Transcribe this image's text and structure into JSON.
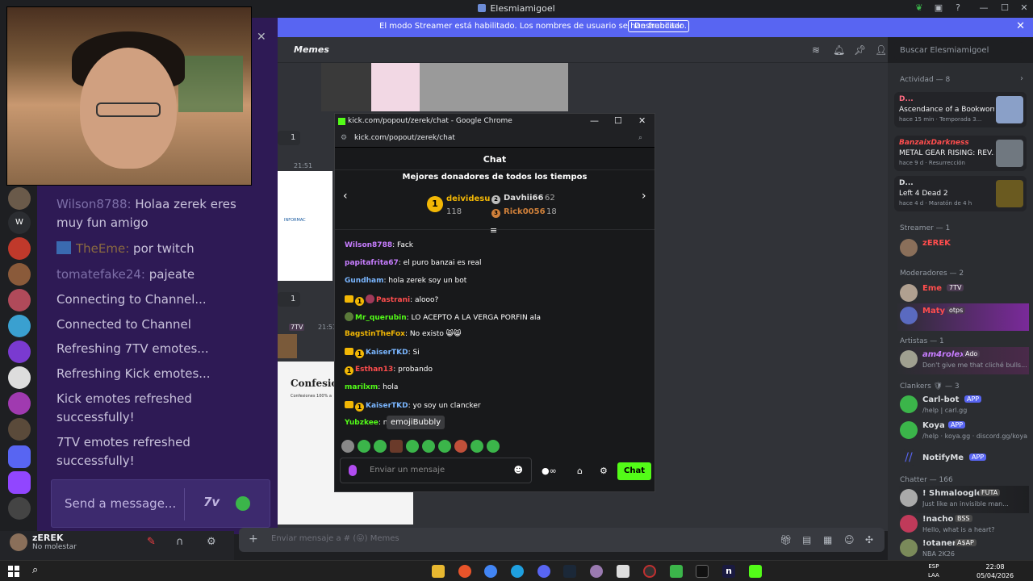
{
  "window": {
    "title": "Elesmiamigoel"
  },
  "banner": {
    "message": "El modo Streamer está habilitado. Los nombres de usuario se han truncado.",
    "button": "Deshabilitar"
  },
  "discord": {
    "channel": "Memes",
    "search_placeholder": "Buscar Elesmiamigoel",
    "input_placeholder": "Enviar mensaje a # (😛) Memes",
    "messages": [
      {
        "time": "21:51",
        "reaction_count": "1"
      },
      {
        "time": "21:51",
        "reaction_count": "1"
      },
      {
        "badge": "7TV",
        "time": "21:51"
      }
    ],
    "doc_preview": {
      "label1": "INFORMAC",
      "label2": "Confesion",
      "label3": "Confesiones 100% a"
    },
    "user": {
      "name": "zEREK",
      "status": "No molestar"
    }
  },
  "overlay": {
    "lines": [
      {
        "name": "Wilson8788:",
        "text": " Holaa zerek eres muy fun amigo"
      },
      {
        "name": "TheEme:",
        "text": " por twitch"
      },
      {
        "name": "tomatefake24:",
        "text": " pajeate"
      },
      {
        "text": "Connecting to Channel..."
      },
      {
        "text": "Connected to Channel"
      },
      {
        "text": "Refreshing 7TV emotes..."
      },
      {
        "text": "Refreshing Kick emotes..."
      },
      {
        "text": "Kick emotes refreshed successfully!"
      },
      {
        "text": "7TV emotes refreshed successfully!"
      }
    ],
    "input_placeholder": "Send a message...",
    "seventv_label": "7v"
  },
  "kick": {
    "window_title": "kick.com/popout/zerek/chat - Google Chrome",
    "url": "kick.com/popout/zerek/chat",
    "chat_title": "Chat",
    "donors_title": "Mejores donadores de todos los tiempos",
    "donors": [
      {
        "rank": "1",
        "name": "deividesu",
        "amount": "118"
      },
      {
        "rank": "2",
        "name": "Davhii66",
        "amount": "62"
      },
      {
        "rank": "3",
        "name": "Rick0056",
        "amount": "18"
      }
    ],
    "messages": [
      {
        "user": "Wilson8788",
        "color": "#c77dff",
        "text": ": Fack"
      },
      {
        "user": "papitafrita67",
        "color": "#c77dff",
        "text": ": el puro banzai es real"
      },
      {
        "user": "Gundham",
        "color": "#7ab6ff",
        "text": ": hola zerek soy un bot"
      },
      {
        "user": "Pastrani",
        "color": "#ff4d4d",
        "text": ": alooo?"
      },
      {
        "user": "Mr_querubin",
        "color": "#53fc18",
        "text": ": LO ACEPTO A LA VERGA PORFIN ala"
      },
      {
        "user": "BagstinTheFox",
        "color": "#f2b705",
        "text": ": No existo 😸😸"
      },
      {
        "user": "KaiserTKD",
        "color": "#7ab6ff",
        "text": ": Si"
      },
      {
        "user": "Esthan13",
        "color": "#ff4d4d",
        "text": ": probando"
      },
      {
        "user": "marilxm",
        "color": "#53fc18",
        "text": ": hola"
      },
      {
        "user": "KaiserTKD",
        "color": "#7ab6ff",
        "text": ": yo soy un clancker"
      },
      {
        "user": "Yubzkee",
        "color": "#53fc18",
        "text": ": n"
      }
    ],
    "tooltip": "emojiBubbly",
    "input_placeholder": "Enviar un mensaje",
    "send_button": "Chat"
  },
  "members": {
    "activity_header": "Actividad — 8",
    "activities": [
      {
        "user": "D...",
        "title": "Ascendance of a Bookworm",
        "meta": "hace 15 min · Temporada 3...",
        "color": "#ff6b81"
      },
      {
        "user": "BanzaixDarkness",
        "title": "METAL GEAR RISING: REV...",
        "meta": "hace 9 d · Resurrección",
        "color": "#ff4d4d"
      },
      {
        "user": "D...",
        "title": "Left 4 Dead 2",
        "meta": "hace 4 d · Maratón de 4 h",
        "color": "#f2f3f5"
      }
    ],
    "groups": [
      {
        "header": "Streamer — 1",
        "rows": [
          {
            "name": "zEREK",
            "color": "#ff4d4d",
            "sub": ""
          }
        ]
      },
      {
        "header": "Moderadores — 2",
        "rows": [
          {
            "name": "Eme",
            "color": "#ff4d4d",
            "badge": "7TV",
            "sub": ""
          },
          {
            "name": "Maty",
            "color": "#ff4d4d",
            "badge": "otps",
            "sub": ""
          }
        ]
      },
      {
        "header": "Artistas — 1",
        "rows": [
          {
            "name": "am4rolex",
            "color": "#c77dff",
            "badge": "Ado",
            "sub": "Don't give me that cliché bulls..."
          }
        ]
      },
      {
        "header": "Clankers 🛡 — 3",
        "rows": [
          {
            "name": "Carl-bot",
            "color": "#f2f3f5",
            "badge": "APP",
            "sub": "/help | carl.gg"
          },
          {
            "name": "Koya",
            "color": "#f2f3f5",
            "badge": "APP",
            "sub": "/help · koya.gg · discord.gg/koya"
          },
          {
            "name": "NotifyMe",
            "color": "#f2f3f5",
            "badge": "APP",
            "sub": ""
          }
        ]
      },
      {
        "header": "Chatter — 166",
        "rows": [
          {
            "name": "! Shmaloogle",
            "color": "#f2f3f5",
            "badge": "FUTA",
            "sub": "Just like an invisible man..."
          },
          {
            "name": "!nacho",
            "color": "#f2f3f5",
            "badge": "BSS",
            "sub": "Hello, what is a heart?"
          },
          {
            "name": "!otaner",
            "color": "#f2f3f5",
            "badge": "A$AP",
            "sub": "NBA 2K26"
          }
        ]
      }
    ]
  },
  "taskbar": {
    "lang1": "ESP",
    "lang2": "LAA",
    "time": "22:08",
    "date": "05/04/2026"
  }
}
